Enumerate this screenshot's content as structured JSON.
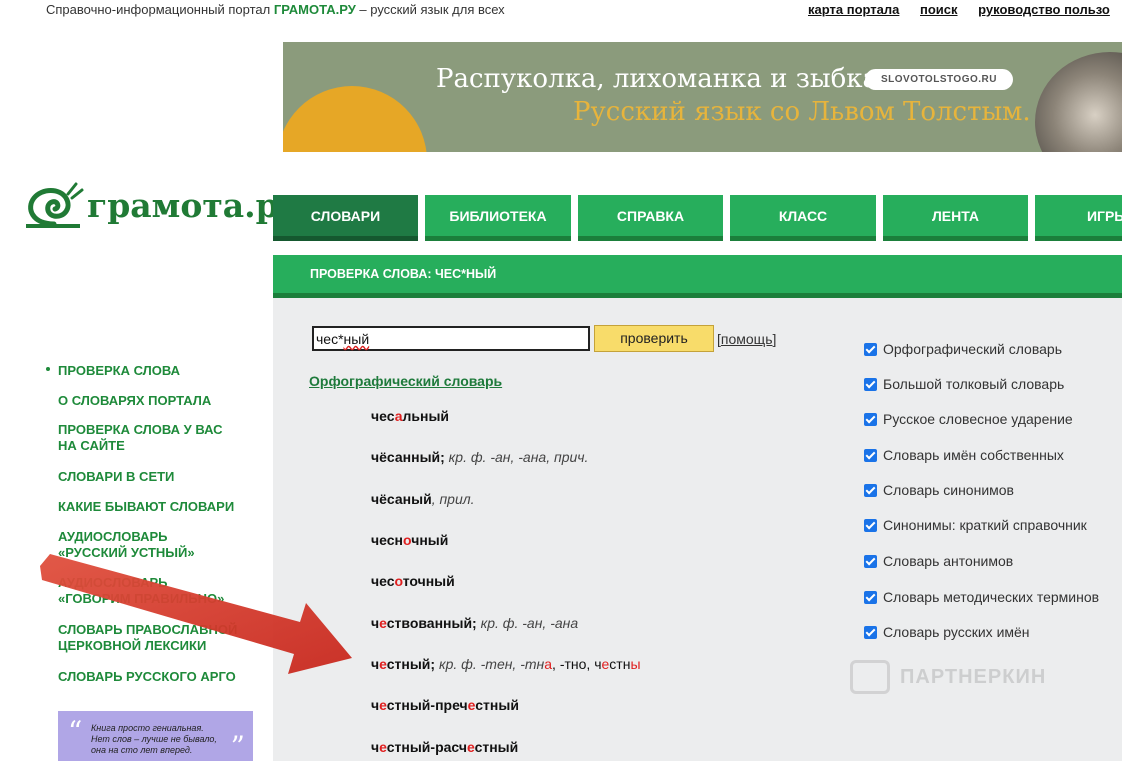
{
  "topbar": {
    "portal_prefix": "Справочно-информационный портал",
    "portal_name": "ГРАМОТА.РУ",
    "portal_suffix": "– русский язык для всех",
    "links": [
      "карта портала",
      "поиск",
      "руководство пользо"
    ]
  },
  "banner": {
    "line1": "Распуколка, лихоманка и зыбка",
    "line2": "Русский язык со Львом Толстым.",
    "badge": "SLOVOTOLSTOGO.RU"
  },
  "logo": {
    "text": "грамота.ру"
  },
  "nav": {
    "tabs": [
      "СЛОВАРИ",
      "БИБЛИОТЕКА",
      "СПРАВКА",
      "КЛАСС",
      "ЛЕНТА",
      "ИГРЫ"
    ],
    "active": "СЛОВАРИ"
  },
  "header": {
    "title": "ПРОВЕРКА СЛОВА: ЧЕС*НЫЙ"
  },
  "search": {
    "value_prefix": "чес*",
    "value_suffix": "ный",
    "button_label": "проверить",
    "help_open": "[",
    "help_label": "помощь",
    "help_close": "]"
  },
  "results": {
    "dictionary_title": "Орфографический словарь",
    "entries": [
      {
        "before": "чес",
        "accent": "а",
        "after": "льный",
        "note": ""
      },
      {
        "before": "чёсанный;",
        "accent": "",
        "after": "",
        "note": " кр. ф. -ан, -ана, прич."
      },
      {
        "before": "чёсаный",
        "accent": "",
        "after": "",
        "note": ", прил."
      },
      {
        "before": "чесн",
        "accent": "о",
        "after": "чный",
        "note": ""
      },
      {
        "before": "чес",
        "accent": "о",
        "after": "точный",
        "note": ""
      },
      {
        "before": "ч",
        "accent": "е",
        "after": "ствованный;",
        "note": " кр. ф. -ан, -ана"
      },
      {
        "before": "ч",
        "accent": "е",
        "after": "стный;",
        "note": " кр. ф. -тен, -тн",
        "note_accent": "а",
        "note_tail": ", -тно, ч",
        "note_accent2": "е",
        "note_tail2": "стн",
        "note_accent3": "ы"
      },
      {
        "before": "ч",
        "accent": "е",
        "after": "стный-преч",
        "accent2": "е",
        "after2": "стный",
        "note": ""
      },
      {
        "before": "ч",
        "accent": "е",
        "after": "стный-расч",
        "accent2": "е",
        "after2": "стный",
        "note": ""
      }
    ]
  },
  "dictionaries": [
    "Орфографический словарь",
    "Большой толковый словарь",
    "Русское словесное ударение",
    "Словарь имён собственных",
    "Словарь синонимов",
    "Синонимы: краткий справочник",
    "Словарь антонимов",
    "Словарь методических терминов",
    "Словарь русских имён"
  ],
  "sidebar": {
    "items": [
      "ПРОВЕРКА СЛОВА",
      "О СЛОВАРЯХ ПОРТАЛА",
      "ПРОВЕРКА СЛОВА У ВАС\nНА САЙТЕ",
      "СЛОВАРИ В СЕТИ",
      "КАКИЕ БЫВАЮТ СЛОВАРИ",
      "АУДИОСЛОВАРЬ\n«РУССКИЙ УСТНЫЙ»",
      "АУДИОСЛОВАРЬ\n«ГОВОРИМ ПРАВИЛЬНО»",
      "СЛОВАРЬ ПРАВОСЛАВНОЙ\nЦЕРКОВНОЙ ЛЕКСИКИ",
      "СЛОВАРЬ РУССКОГО АРГО"
    ]
  },
  "quote": {
    "text": "Книга просто гениальная.\nНет слов – лучше не бывало,\nона на сто лет вперед."
  },
  "watermark": {
    "text": "ПАРТНЕРКИН"
  },
  "colors": {
    "green": "#27ae5c",
    "dark_green": "#1f7a44",
    "accent_red": "#e02020",
    "arrow": "#e03b2a",
    "button_yellow": "#f8dc6a"
  }
}
